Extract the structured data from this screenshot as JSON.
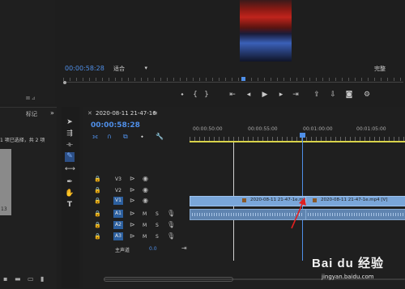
{
  "program_monitor": {
    "timecode": "00:00:58:28",
    "fit_select": "适合",
    "quality_select": "完整",
    "transport_icons": [
      "marker-icon",
      "mark-in-icon",
      "mark-out-icon",
      "go-to-in-icon",
      "step-back-icon",
      "play-icon",
      "step-forward-icon",
      "go-to-out-icon",
      "lift-icon",
      "extract-icon",
      "export-frame-icon",
      "settings-icon"
    ]
  },
  "left_panel": {
    "tab_label": "标记",
    "selection_info": "1 项已选择，共 2 项",
    "thumb_duration": "13"
  },
  "tools": [
    "selection-tool",
    "track-select-tool",
    "ripple-edit-tool",
    "razor-tool",
    "slip-tool",
    "pen-tool",
    "hand-tool",
    "type-tool"
  ],
  "timeline": {
    "sequence_name": "2020-08-11 21-47-16",
    "timecode": "00:00:58:28",
    "ruler": [
      "00:00:50:00",
      "00:00:55:00",
      "00:01:00:00",
      "00:01:05:00"
    ],
    "video_tracks": [
      {
        "name": "V3"
      },
      {
        "name": "V2"
      },
      {
        "name": "V1"
      }
    ],
    "audio_tracks": [
      {
        "name": "A1",
        "m": "M",
        "s": "S"
      },
      {
        "name": "A2",
        "m": "M",
        "s": "S"
      },
      {
        "name": "A3",
        "m": "M",
        "s": "S"
      }
    ],
    "master_label": "主声道",
    "master_value": "0.0",
    "clip1_label": "2020-08-11 21-47-1e.mp4 [V]",
    "clip2_label": "2020-08-11 21-47-1e.mp4 [V]"
  },
  "watermark": {
    "text": "Bai du 经验",
    "url": "jingyan.baidu.com"
  },
  "colors": {
    "accent_blue": "#4f8fe8",
    "annotation_red": "#e02020",
    "clip_video": "#7aa6d9",
    "clip_audio": "#5f84b0"
  }
}
